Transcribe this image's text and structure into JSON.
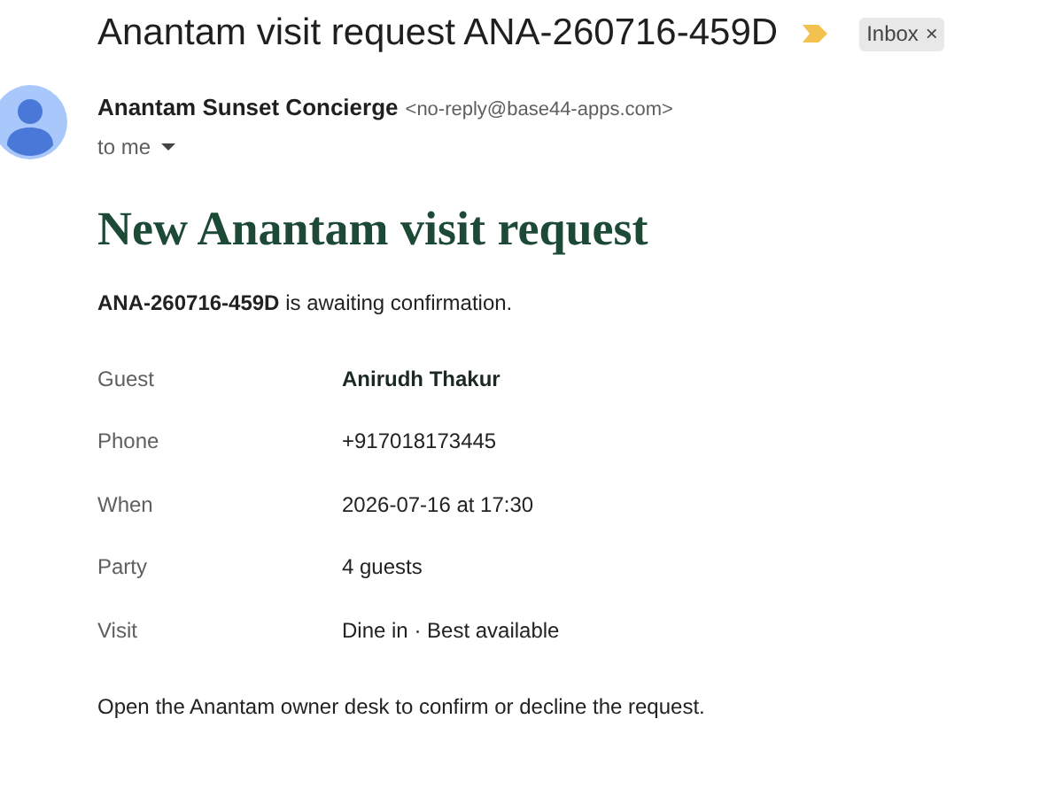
{
  "subject": "Anantam visit request ANA-260716-459D",
  "label": {
    "text": "Inbox",
    "close": "×"
  },
  "sender": {
    "name": "Anantam Sunset Concierge",
    "address": "<no-reply@base44-apps.com>",
    "recipient": "to me"
  },
  "body": {
    "heading": "New Anantam visit request",
    "summary": "**ANA-260716-459D** is awaiting confirmation.",
    "details": [
      {
        "label": "Guest",
        "value": "Anirudh Thakur",
        "emphasis": true
      },
      {
        "label": "Phone",
        "value": "+917018173445",
        "emphasis": false
      },
      {
        "label": "When",
        "value": "2026-07-16 at 17:30",
        "emphasis": false
      },
      {
        "label": "Party",
        "value": "4 guests",
        "emphasis": false
      },
      {
        "label": "Visit",
        "value": "Dine in · Best available",
        "emphasis": false
      }
    ],
    "footer": "Open the Anantam owner desk to confirm or decline the request."
  }
}
